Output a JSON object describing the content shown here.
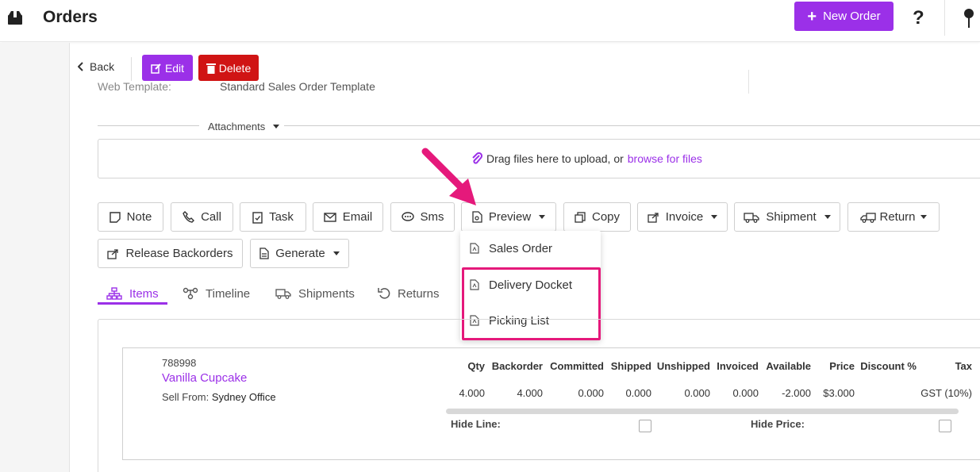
{
  "header": {
    "title": "Orders",
    "new_order_label": "New Order",
    "help_glyph": "?"
  },
  "toolbar": {
    "back_label": "Back",
    "edit_label": "Edit",
    "delete_label": "Delete"
  },
  "order": {
    "web_template_label": "Web Template:",
    "web_template_value": "Standard Sales Order Template"
  },
  "attachments": {
    "label": "Attachments",
    "drop_text": "Drag files here to upload, or",
    "browse_text": "browse for files"
  },
  "actions": [
    {
      "label": "Note",
      "icon": "note-icon"
    },
    {
      "label": "Call",
      "icon": "phone-icon"
    },
    {
      "label": "Task",
      "icon": "clipboard-icon"
    },
    {
      "label": "Email",
      "icon": "envelope-icon"
    },
    {
      "label": "Sms",
      "icon": "chat-icon"
    },
    {
      "label": "Preview",
      "icon": "document-search-icon"
    },
    {
      "label": "Copy",
      "icon": "copy-icon"
    },
    {
      "label": "Invoice",
      "icon": "share-icon"
    },
    {
      "label": "Shipment",
      "icon": "truck-icon"
    },
    {
      "label": "Return",
      "icon": "truck-return-icon"
    },
    {
      "label": "Release Backorders",
      "icon": "share-icon"
    },
    {
      "label": "Generate",
      "icon": "document-icon"
    }
  ],
  "preview_menu": [
    {
      "label": "Sales Order",
      "icon": "pdf-icon"
    },
    {
      "label": "Delivery Docket",
      "icon": "pdf-icon"
    },
    {
      "label": "Picking List",
      "icon": "pdf-icon"
    }
  ],
  "tabs": [
    {
      "label": "Items",
      "icon": "sitemap-icon",
      "active": true
    },
    {
      "label": "Timeline",
      "icon": "timeline-icon"
    },
    {
      "label": "Shipments",
      "icon": "truck-icon"
    },
    {
      "label": "Returns",
      "icon": "undo-icon"
    }
  ],
  "line_item": {
    "sku": "788998",
    "name": "Vanilla Cupcake",
    "sell_from_label": "Sell From:",
    "sell_from_value": "Sydney Office",
    "columns": [
      "Qty",
      "Backorder",
      "Committed",
      "Shipped",
      "Unshipped",
      "Invoiced",
      "Available",
      "Price",
      "Discount %",
      "Tax"
    ],
    "values": [
      "4.000",
      "4.000",
      "0.000",
      "0.000",
      "0.000",
      "0.000",
      "-2.000",
      "$3.000",
      "",
      "GST (10%)"
    ],
    "hide_line_label": "Hide Line:",
    "hide_price_label": "Hide Price:"
  },
  "colors": {
    "accent": "#9b30e8",
    "danger": "#d01414",
    "annotation": "#e5197b"
  }
}
